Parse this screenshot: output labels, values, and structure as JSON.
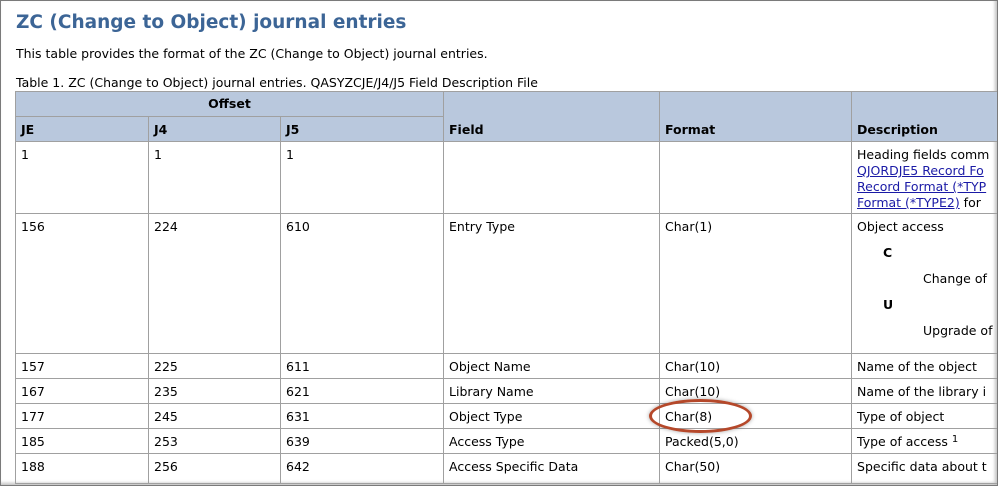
{
  "title": "ZC (Change to Object) journal entries",
  "intro": "This table provides the format of the ZC (Change to Object) journal entries.",
  "caption": "Table 1. ZC (Change to Object) journal entries. QASYZCJE/J4/J5 Field Description File",
  "headers": {
    "offset": "Offset",
    "je": "JE",
    "j4": "J4",
    "j5": "J5",
    "field": "Field",
    "format": "Format",
    "description": "Description"
  },
  "rows": [
    {
      "je": "1",
      "j4": "1",
      "j5": "1",
      "field": "",
      "format": "",
      "desc_prefix": "Heading fields comm",
      "links": [
        "QJORDJE5 Record Fo",
        "Record Format (*TYP",
        "Format (*TYPE2)"
      ],
      "desc_suffix": " for"
    },
    {
      "je": "156",
      "j4": "224",
      "j5": "610",
      "field": "Entry Type",
      "format": "Char(1)",
      "desc": "Object access",
      "values": [
        {
          "code": "C",
          "text": "Change of"
        },
        {
          "code": "U",
          "text": "Upgrade of"
        }
      ]
    },
    {
      "je": "157",
      "j4": "225",
      "j5": "611",
      "field": "Object Name",
      "format": "Char(10)",
      "desc": "Name of the object"
    },
    {
      "je": "167",
      "j4": "235",
      "j5": "621",
      "field": "Library Name",
      "format": "Char(10)",
      "desc": "Name of the library i"
    },
    {
      "je": "177",
      "j4": "245",
      "j5": "631",
      "field": "Object Type",
      "format": "Char(8)",
      "desc": "Type of object"
    },
    {
      "je": "185",
      "j4": "253",
      "j5": "639",
      "field": "Access Type",
      "format": "Packed(5,0)",
      "desc": "Type of access",
      "footnote": "1"
    },
    {
      "je": "188",
      "j4": "256",
      "j5": "642",
      "field": "Access Specific Data",
      "format": "Char(50)",
      "desc": "Specific data about t"
    }
  ],
  "colors": {
    "title": "#3c6596",
    "header_bg": "#b9c8dd",
    "link": "#1a1aa6",
    "highlight": "#b5482a"
  }
}
